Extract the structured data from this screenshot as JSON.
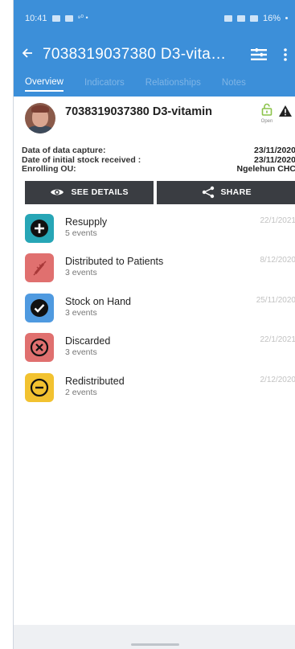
{
  "status_bar": {
    "time": "10:41",
    "extra": "⁹⁰ •",
    "battery": "16%"
  },
  "app_bar": {
    "title": "7038319037380 D3-vita…"
  },
  "tabs": [
    {
      "label": "Overview",
      "active": true
    },
    {
      "label": "Indicators",
      "active": false
    },
    {
      "label": "Relationships",
      "active": false
    },
    {
      "label": "Notes",
      "active": false
    }
  ],
  "entity": {
    "name": "7038319037380 D3-vitamin",
    "lock_label": "Open"
  },
  "info": [
    {
      "label": "Data of data capture:",
      "value": "23/11/2020"
    },
    {
      "label": "Date of initial stock received :",
      "value": "23/11/2020"
    },
    {
      "label": "Enrolling OU:",
      "value": "Ngelehun CHC"
    }
  ],
  "actions": {
    "details_label": "SEE DETAILS",
    "share_label": "SHARE"
  },
  "events": [
    {
      "name": "Resupply",
      "count": "5 events",
      "date": "22/1/2021",
      "icon": "plus-circle-icon",
      "color": "#27a6b6"
    },
    {
      "name": "Distributed to Patients",
      "count": "3 events",
      "date": "8/12/2020",
      "icon": "syringe-icon",
      "color": "#e0706f"
    },
    {
      "name": "Stock on Hand",
      "count": "3 events",
      "date": "25/11/2020",
      "icon": "check-circle-icon",
      "color": "#4f9ae0"
    },
    {
      "name": "Discarded",
      "count": "3 events",
      "date": "22/1/2021",
      "icon": "x-circle-icon",
      "color": "#e0706f"
    },
    {
      "name": "Redistributed",
      "count": "2 events",
      "date": "2/12/2020",
      "icon": "minus-circle-icon",
      "color": "#f2c230"
    }
  ],
  "colors": {
    "primary": "#3c8fd9",
    "button": "#3a3d42",
    "lock": "#8bc34a"
  }
}
